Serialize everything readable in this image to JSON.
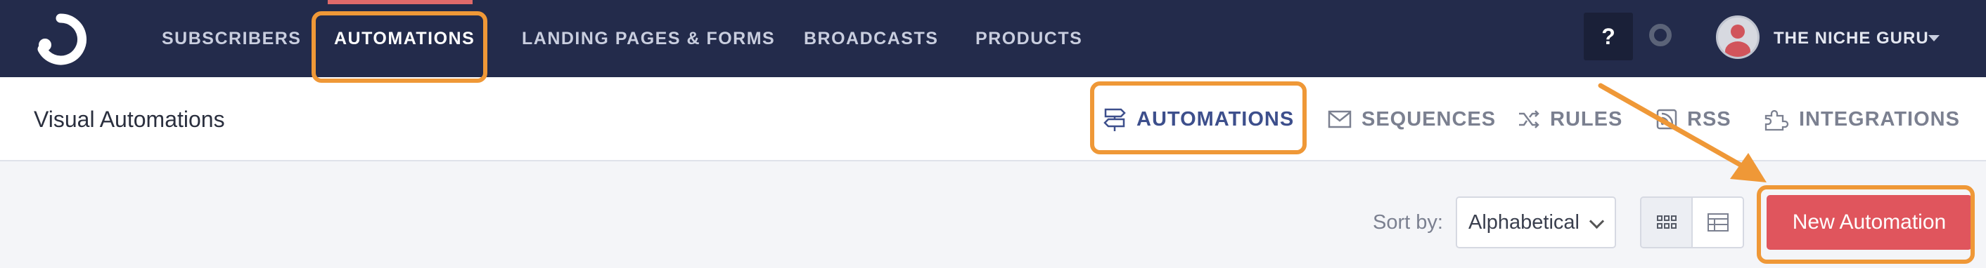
{
  "topnav": {
    "logo_name": "convertkit-logo",
    "items": [
      {
        "label": "SUBSCRIBERS"
      },
      {
        "label": "AUTOMATIONS"
      },
      {
        "label": "LANDING PAGES & FORMS"
      },
      {
        "label": "BROADCASTS"
      },
      {
        "label": "PRODUCTS"
      }
    ],
    "active_index": 1,
    "help_label": "?",
    "account_name": "THE NICHE GURU"
  },
  "subnav": {
    "page_title": "Visual Automations",
    "tabs": [
      {
        "label": "AUTOMATIONS",
        "icon": "signpost-icon"
      },
      {
        "label": "SEQUENCES",
        "icon": "envelope-icon"
      },
      {
        "label": "RULES",
        "icon": "shuffle-icon"
      },
      {
        "label": "RSS",
        "icon": "rss-icon"
      },
      {
        "label": "INTEGRATIONS",
        "icon": "puzzle-icon"
      }
    ],
    "active_tab": 0
  },
  "toolbar": {
    "sort_label": "Sort by:",
    "sort_value": "Alphabetical",
    "view_modes": [
      "grid-view-icon",
      "list-view-icon"
    ],
    "new_button_label": "New Automation"
  },
  "colors": {
    "nav_bg": "#232b4b",
    "accent": "#e0555d",
    "highlight": "#ef9837",
    "active_tab": "#3d4f8c"
  }
}
